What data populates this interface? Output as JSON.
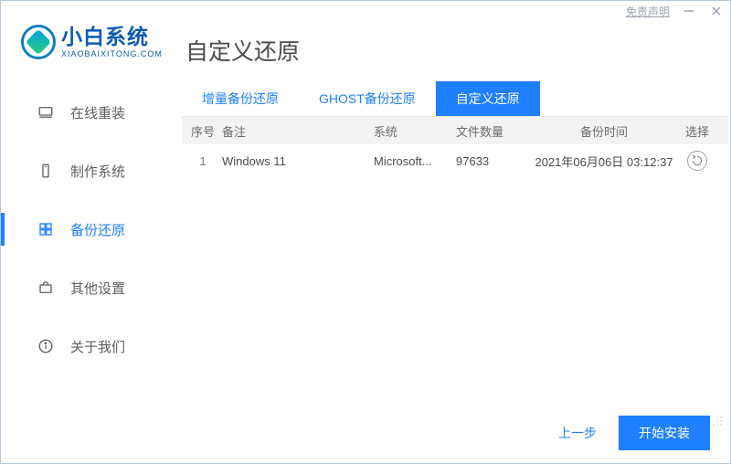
{
  "titlebar": {
    "disclaimer": "免责声明"
  },
  "brand": {
    "title": "小白系统",
    "subtitle": "XIAOBAIXITONG.COM"
  },
  "sidebar": {
    "items": [
      {
        "label": "在线重装"
      },
      {
        "label": "制作系统"
      },
      {
        "label": "备份还原"
      },
      {
        "label": "其他设置"
      },
      {
        "label": "关于我们"
      }
    ]
  },
  "page": {
    "title": "自定义还原",
    "tabs": [
      {
        "label": "增量备份还原"
      },
      {
        "label": "GHOST备份还原"
      },
      {
        "label": "自定义还原"
      }
    ],
    "columns": {
      "index": "序号",
      "note": "备注",
      "system": "系统",
      "count": "文件数量",
      "time": "备份时间",
      "select": "选择"
    },
    "rows": [
      {
        "index": "1",
        "note": "Windows 11",
        "system": "Microsoft...",
        "count": "97633",
        "time": "2021年06月06日 03:12:37"
      }
    ]
  },
  "footer": {
    "prev": "上一步",
    "install": "开始安装"
  }
}
